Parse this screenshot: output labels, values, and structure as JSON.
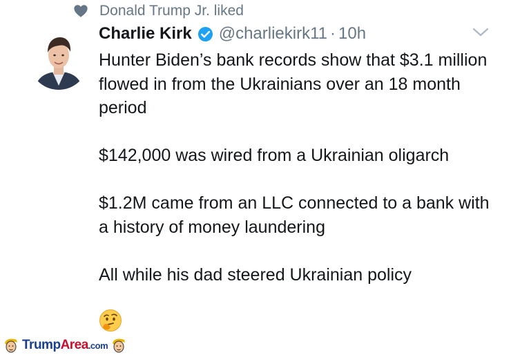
{
  "social_context": {
    "text": "Donald Trump Jr. liked",
    "icon": "heart-icon"
  },
  "tweet": {
    "author_name": "Charlie Kirk",
    "verified_icon": "verified-badge-icon",
    "handle": "@charliekirk11",
    "separator": "·",
    "time": "10h",
    "menu_icon": "chevron-down-icon",
    "paragraphs": [
      "Hunter Biden’s bank records show that $3.1 million flowed in from the Ukrainians over an 18 month period",
      "$142,000 was wired from a Ukrainian oligarch",
      "$1.2M came from an LLC connected to a bank with a history of money laundering",
      "All while his dad steered Ukrainian policy"
    ],
    "emoji": "thinking-face-emoji"
  },
  "watermark": {
    "brand_1": "Trump",
    "brand_2": "Area",
    "brand_3": ".com"
  },
  "colors": {
    "text": "#14171a",
    "secondary": "#657786",
    "verified": "#1da1f2",
    "brand_blue": "#1a3f8f",
    "brand_red": "#c8102e"
  }
}
